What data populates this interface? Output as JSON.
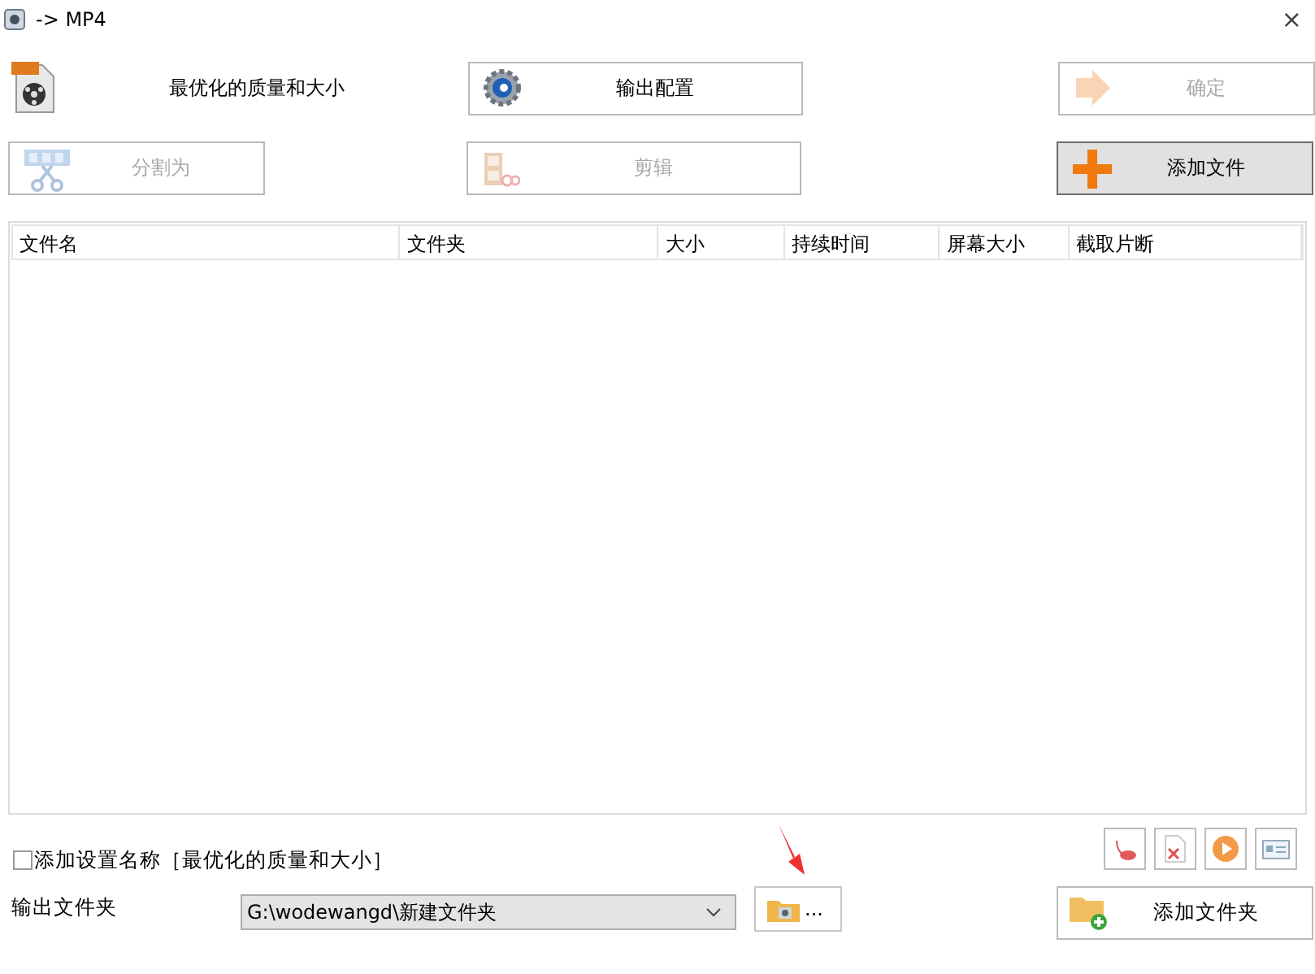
{
  "window": {
    "title": "-> MP4",
    "close": "×"
  },
  "preset_label": "最优化的质量和大小",
  "buttons": {
    "output_config": {
      "label": "输出配置",
      "disabled": false,
      "highlighted": false
    },
    "confirm": {
      "label": "确定",
      "disabled": true,
      "highlighted": false
    },
    "split": {
      "label": "分割为",
      "disabled": true,
      "highlighted": false
    },
    "clip": {
      "label": "剪辑",
      "disabled": true,
      "highlighted": false
    },
    "add_file": {
      "label": "添加文件",
      "disabled": false,
      "highlighted": true
    }
  },
  "table": {
    "columns": [
      "文件名",
      "文件夹",
      "大小",
      "持续时间",
      "屏幕大小",
      "截取片断"
    ]
  },
  "add_preset_name": {
    "label": "添加设置名称［最优化的质量和大小］",
    "checked": false
  },
  "output_folder": {
    "label": "输出文件夹",
    "value": "G:\\wodewangd\\新建文件夹",
    "browse": "...",
    "add_folder": "添加文件夹"
  }
}
